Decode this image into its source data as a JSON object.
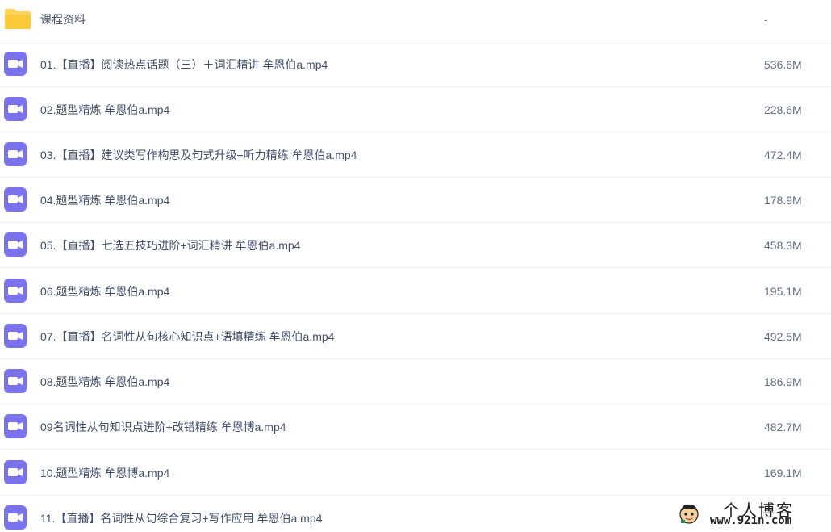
{
  "colors": {
    "video_icon": "#7b72ee",
    "folder_icon": "#fdd35c",
    "text": "#424e67",
    "size_text": "#636d7e",
    "divider": "#f2f4f7"
  },
  "files": [
    {
      "type": "folder",
      "icon": "folder-icon",
      "name": "课程资料",
      "size": "-"
    },
    {
      "type": "video",
      "icon": "video-file-icon",
      "name": "01.【直播】阅读热点话题（三）＋词汇精讲 牟恩伯a.mp4",
      "size": "536.6M"
    },
    {
      "type": "video",
      "icon": "video-file-icon",
      "name": "02.题型精炼 牟恩伯a.mp4",
      "size": "228.6M"
    },
    {
      "type": "video",
      "icon": "video-file-icon",
      "name": "03.【直播】建议类写作构思及句式升级+听力精练 牟恩伯a.mp4",
      "size": "472.4M"
    },
    {
      "type": "video",
      "icon": "video-file-icon",
      "name": "04.题型精炼 牟恩伯a.mp4",
      "size": "178.9M"
    },
    {
      "type": "video",
      "icon": "video-file-icon",
      "name": "05.【直播】七选五技巧进阶+词汇精讲 牟恩伯a.mp4",
      "size": "458.3M"
    },
    {
      "type": "video",
      "icon": "video-file-icon",
      "name": "06.题型精炼 牟恩伯a.mp4",
      "size": "195.1M"
    },
    {
      "type": "video",
      "icon": "video-file-icon",
      "name": "07.【直播】名词性从句核心知识点+语填精练 牟恩伯a.mp4",
      "size": "492.5M"
    },
    {
      "type": "video",
      "icon": "video-file-icon",
      "name": "08.题型精炼 牟恩伯a.mp4",
      "size": "186.9M"
    },
    {
      "type": "video",
      "icon": "video-file-icon",
      "name": "09名词性从句知识点进阶+改错精练 牟恩博a.mp4",
      "size": "482.7M"
    },
    {
      "type": "video",
      "icon": "video-file-icon",
      "name": "10.题型精炼 牟恩博a.mp4",
      "size": "169.1M"
    },
    {
      "type": "video",
      "icon": "video-file-icon",
      "name": "11.【直播】名词性从句综合复习+写作应用 牟恩伯a.mp4",
      "size": ""
    }
  ],
  "watermark": {
    "title": "个人博客",
    "url": "www.92in.com",
    "icon": "avatar-cartoon-icon"
  }
}
